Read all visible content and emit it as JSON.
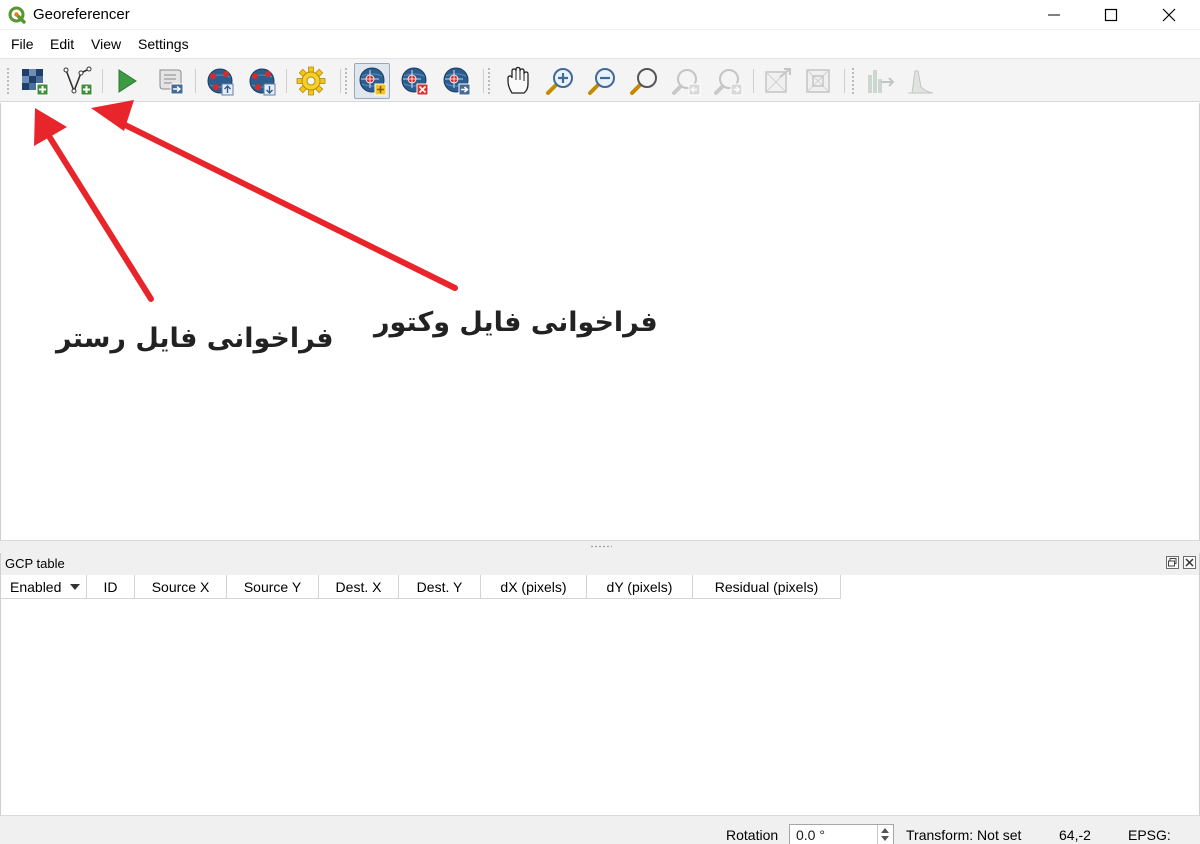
{
  "window": {
    "title": "Georeferencer",
    "logo_icon": "qgis-logo-icon"
  },
  "menu": [
    "File",
    "Edit",
    "View",
    "Settings"
  ],
  "toolbar": {
    "buttons": [
      {
        "id": "open-raster",
        "icon": "open-raster-icon",
        "enabled": true
      },
      {
        "id": "open-vector",
        "icon": "open-vector-icon",
        "enabled": true
      },
      {
        "id": "start-georeferencing",
        "icon": "play-icon",
        "enabled": true
      },
      {
        "id": "generate-gdal-script",
        "icon": "gdal-script-icon",
        "enabled": true
      },
      {
        "id": "load-gcp-points",
        "icon": "load-gcp-icon",
        "enabled": true
      },
      {
        "id": "save-gcp-points",
        "icon": "save-gcp-icon",
        "enabled": true
      },
      {
        "id": "transformation-settings",
        "icon": "settings-gear-icon",
        "enabled": true
      },
      {
        "id": "add-point",
        "icon": "add-point-icon",
        "enabled": true,
        "active": true
      },
      {
        "id": "delete-point",
        "icon": "delete-point-icon",
        "enabled": true
      },
      {
        "id": "move-gcp-point",
        "icon": "move-point-icon",
        "enabled": true
      },
      {
        "id": "pan",
        "icon": "pan-hand-icon",
        "enabled": true
      },
      {
        "id": "zoom-in",
        "icon": "zoom-in-icon",
        "enabled": true
      },
      {
        "id": "zoom-out",
        "icon": "zoom-out-icon",
        "enabled": true
      },
      {
        "id": "zoom-to-layer",
        "icon": "zoom-to-layer-icon",
        "enabled": true
      },
      {
        "id": "zoom-last",
        "icon": "zoom-last-icon",
        "enabled": false
      },
      {
        "id": "zoom-next",
        "icon": "zoom-next-icon",
        "enabled": false
      },
      {
        "id": "link-georeferencer-to-qgis",
        "icon": "link-geo-to-qgis-icon",
        "enabled": false
      },
      {
        "id": "link-qgis-to-georeferencer",
        "icon": "link-qgis-to-geo-icon",
        "enabled": false
      },
      {
        "id": "full-histogram-stretch",
        "icon": "histogram-stretch-icon",
        "enabled": false
      },
      {
        "id": "local-histogram-stretch",
        "icon": "local-histogram-icon",
        "enabled": false
      }
    ]
  },
  "annotations": {
    "raster_label": "فراخوانی فایل رستر",
    "vector_label": "فراخوانی فایل وکتور",
    "arrow_color": "#e8252b"
  },
  "gcp_table": {
    "title": "GCP table",
    "columns": [
      "Enabled",
      "ID",
      "Source X",
      "Source Y",
      "Dest. X",
      "Dest. Y",
      "dX (pixels)",
      "dY (pixels)",
      "Residual (pixels)"
    ],
    "rows": []
  },
  "statusbar": {
    "rotation_label": "Rotation",
    "rotation_value": "0.0 °",
    "transform_text": "Transform: Not set",
    "coordinates": "64,-2",
    "epsg_label": "EPSG:"
  }
}
